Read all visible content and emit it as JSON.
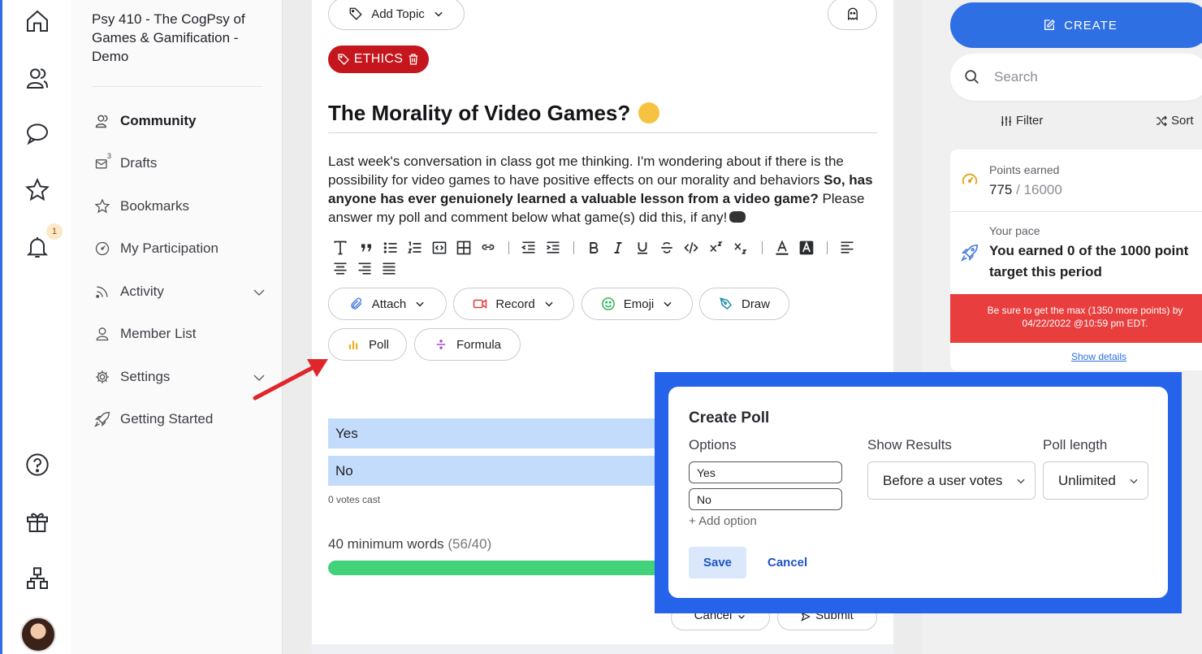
{
  "rail": {
    "notification_count": "1"
  },
  "sidebar": {
    "course_title": "Psy 410 - The CogPsy of Games & Gamification - Demo",
    "drafts_count": "3",
    "items": [
      {
        "label": "Community",
        "icon": "community-icon"
      },
      {
        "label": "Drafts",
        "icon": "drafts-icon"
      },
      {
        "label": "Bookmarks",
        "icon": "star-icon"
      },
      {
        "label": "My Participation",
        "icon": "gauge-icon"
      },
      {
        "label": "Activity",
        "icon": "activity-icon"
      },
      {
        "label": "Member List",
        "icon": "user-icon"
      },
      {
        "label": "Settings",
        "icon": "gear-icon"
      },
      {
        "label": "Getting Started",
        "icon": "rocket-icon"
      }
    ]
  },
  "editor": {
    "add_topic_label": "Add Topic",
    "tag_label": "ETHICS",
    "title": "The Morality of Video Games?",
    "body_normal_1": "Last week's conversation in class got me thinking. I'm wondering about if there is the possibility for video games to have positive effects on our morality and behaviors ",
    "body_bold": "So, has anyone has ever genuionely learned a valuable lesson from a video game?",
    "body_normal_2": " Please answer my poll and comment below what game(s) did this, if any!",
    "buttons": {
      "attach": "Attach",
      "record": "Record",
      "emoji": "Emoji",
      "draw": "Draw",
      "poll": "Poll",
      "formula": "Formula"
    },
    "poll_options": [
      "Yes",
      "No"
    ],
    "votes_cast": "0 votes cast",
    "min_words_label": "40 minimum words",
    "min_words_count": "(56/40)",
    "word_progress": 1.0,
    "cancel_label": "Cancel",
    "submit_label": "Submit"
  },
  "right": {
    "create_label": "CREATE",
    "search_placeholder": "Search",
    "filter_label": "Filter",
    "sort_label": "Sort",
    "points_label": "Points earned",
    "points_value": "775",
    "points_total": "/ 16000",
    "pace_label": "Your pace",
    "pace_text": "You earned 0 of the 1000 point target this period",
    "warning": "Be sure to get the max (1350 more points) by 04/22/2022 @10:59 pm EDT.",
    "show_details": "Show details"
  },
  "modal": {
    "title": "Create Poll",
    "options_label": "Options",
    "show_results_label": "Show Results",
    "poll_length_label": "Poll length",
    "option_values": [
      "Yes",
      "No"
    ],
    "add_option": "+ Add option",
    "show_results_value": "Before a user votes",
    "poll_length_value": "Unlimited",
    "save": "Save",
    "cancel": "Cancel"
  },
  "colors": {
    "accent": "#2f6fe4",
    "tag_red": "#c5161d",
    "warning_red": "#e83e3e",
    "progress_green": "#41d27a",
    "poll_option": "#c4dcfb"
  }
}
